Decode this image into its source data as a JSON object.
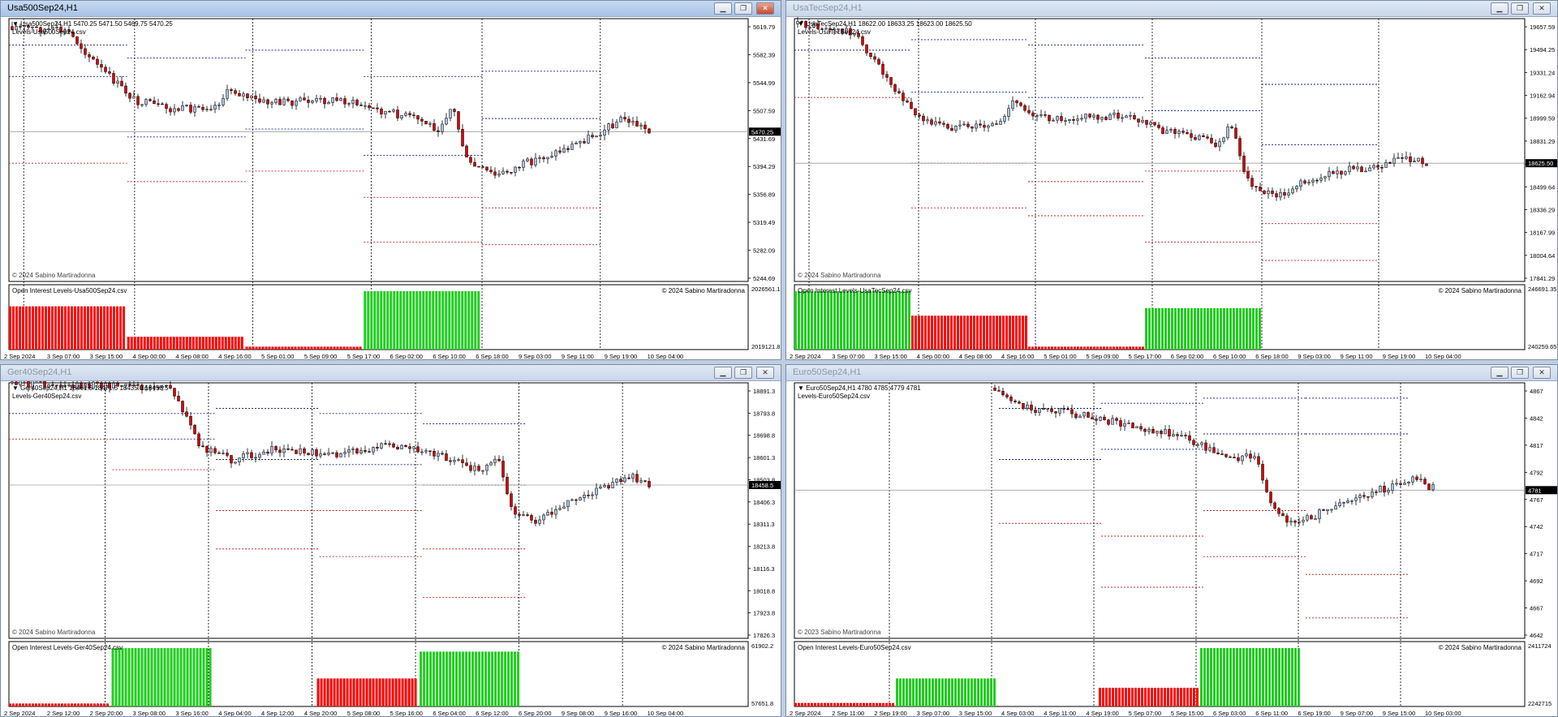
{
  "windows": [
    {
      "title": "Usa500Sep24,H1",
      "active": true,
      "info_line": "Usa500Sep24,H1  5470.25 5471.50 5469.75 5470.25",
      "levels_label": "Levels-Usa500Sep24.csv",
      "copyright_main": "© 2024 Sabino Martiradonna",
      "sub_label": "Open Interest Levels-Usa500Sep24.csv",
      "copyright_sub": "© 2024 Sabino Martiradonna",
      "price_ticks": [
        "5619.79",
        "5582.39",
        "5544.99",
        "5507.59",
        "5431.69",
        "5394.29",
        "5356.89",
        "5319.49",
        "5282.09",
        "5244.69"
      ],
      "current_price": "5470.25",
      "sub_ticks": [
        "2026561.1",
        "2019121.8"
      ],
      "time_labels": [
        "2 Sep 2024",
        "3 Sep 07:00",
        "3 Sep 15:00",
        "4 Sep 00:00",
        "4 Sep 08:00",
        "4 Sep 16:00",
        "5 Sep 01:00",
        "5 Sep 09:00",
        "5 Sep 17:00",
        "6 Sep 02:00",
        "6 Sep 10:00",
        "6 Sep 18:00",
        "9 Sep 03:00",
        "9 Sep 11:00",
        "9 Sep 19:00",
        "10 Sep 04:00"
      ],
      "bars": [
        {
          "color": "#ff0000",
          "value": 0.74
        },
        {
          "color": "#ff0000",
          "value": 0.22
        },
        {
          "color": "#ff0000",
          "value": 0.05
        },
        {
          "color": "#22cc22",
          "value": 1.0
        }
      ]
    },
    {
      "title": "UsaTecSep24,H1",
      "active": false,
      "info_line": "UsaTecSep24,H1  18622.00 18633.25 18623.00 18625.50",
      "levels_label": "Levels-UsaTecSep24.csv",
      "copyright_main": "© 2024 Sabino Martiradonna",
      "sub_label": "Open Interest Levels-UsaTecSep24.csv",
      "copyright_sub": "© 2024 Sabino Martiradonna",
      "price_ticks": [
        "19657.59",
        "19494.25",
        "19331.24",
        "19162.94",
        "18999.59",
        "18831.29",
        "18667.94",
        "18499.64",
        "18336.29",
        "18167.99",
        "18004.64",
        "17841.29"
      ],
      "current_price": "18625.50",
      "sub_ticks": [
        "246691.35",
        "240259.65"
      ],
      "time_labels": [
        "2 Sep 2024",
        "3 Sep 07:00",
        "3 Sep 15:00",
        "4 Sep 00:00",
        "4 Sep 08:00",
        "4 Sep 16:00",
        "5 Sep 01:00",
        "5 Sep 09:00",
        "5 Sep 17:00",
        "6 Sep 02:00",
        "6 Sep 10:00",
        "6 Sep 18:00",
        "9 Sep 03:00",
        "9 Sep 11:00",
        "9 Sep 19:00",
        "10 Sep 04:00"
      ],
      "bars": [
        {
          "color": "#22cc22",
          "value": 1.0
        },
        {
          "color": "#ff0000",
          "value": 0.58
        },
        {
          "color": "#ff0000",
          "value": 0.05
        },
        {
          "color": "#22cc22",
          "value": 0.71
        }
      ]
    },
    {
      "title": "Ger40Sep24,H1",
      "active": false,
      "info_line": "Ger40Sep24,H1  18461.5 18471.5 18435.0 18458.5",
      "levels_label": "Levels-Ger40Sep24.csv",
      "copyright_main": "© 2024 Sabino Martiradonna",
      "sub_label": "Open Interest Levels-Ger40Sep24.csv",
      "copyright_sub": "© 2024 Sabino Martiradonna",
      "price_ticks": [
        "18891.3",
        "18793.8",
        "18698.8",
        "18601.3",
        "18503.8",
        "18406.3",
        "18311.3",
        "18213.8",
        "18116.3",
        "18018.8",
        "17923.8",
        "17826.3"
      ],
      "current_price": "18458.5",
      "sub_ticks": [
        "61902.2",
        "57651.8"
      ],
      "time_labels": [
        "2 Sep 2024",
        "2 Sep 12:00",
        "2 Sep 20:00",
        "3 Sep 08:00",
        "3 Sep 16:00",
        "4 Sep 04:00",
        "4 Sep 12:00",
        "4 Sep 20:00",
        "5 Sep 08:00",
        "5 Sep 16:00",
        "6 Sep 04:00",
        "6 Sep 12:00",
        "6 Sep 20:00",
        "9 Sep 08:00",
        "9 Sep 16:00",
        "10 Sep 04:00"
      ],
      "bars": [
        {
          "color": "#ff0000",
          "value": 0.05
        },
        {
          "color": "#22cc22",
          "value": 1.0
        },
        {
          "color": "#ff0000",
          "value": 0.0
        },
        {
          "color": "#ff0000",
          "value": 0.48
        },
        {
          "color": "#22cc22",
          "value": 0.94
        }
      ]
    },
    {
      "title": "Euro50Sep24,H1",
      "active": false,
      "info_line": "Euro50Sep24,H1  4780 4785 4779 4781",
      "levels_label": "Levels-Euro50Sep24.csv",
      "copyright_main": "© 2023 Sabino Martiradonna",
      "sub_label": "Open Interest Levels-Euro50Sep24.csv",
      "copyright_sub": "© 2024 Sabino Martiradonna",
      "price_ticks": [
        "4867",
        "4842",
        "4817",
        "4792",
        "4767",
        "4742",
        "4717",
        "4692",
        "4667",
        "4642"
      ],
      "current_price": "4781",
      "sub_ticks": [
        "2411724",
        "2242715"
      ],
      "time_labels": [
        "2 Sep 2024",
        "2 Sep 11:00",
        "2 Sep 19:00",
        "3 Sep 07:00",
        "3 Sep 15:00",
        "4 Sep 03:00",
        "4 Sep 11:00",
        "4 Sep 19:00",
        "5 Sep 07:00",
        "5 Sep 15:00",
        "6 Sep 03:00",
        "6 Sep 11:00",
        "6 Sep 19:00",
        "9 Sep 07:00",
        "9 Sep 15:00",
        "10 Sep 03:00"
      ],
      "bars": [
        {
          "color": "#ff0000",
          "value": 0.06
        },
        {
          "color": "#22cc22",
          "value": 0.48
        },
        {
          "color": "#ff0000",
          "value": 0.0
        },
        {
          "color": "#ff0000",
          "value": 0.32
        },
        {
          "color": "#22cc22",
          "value": 1.0
        }
      ]
    }
  ]
}
